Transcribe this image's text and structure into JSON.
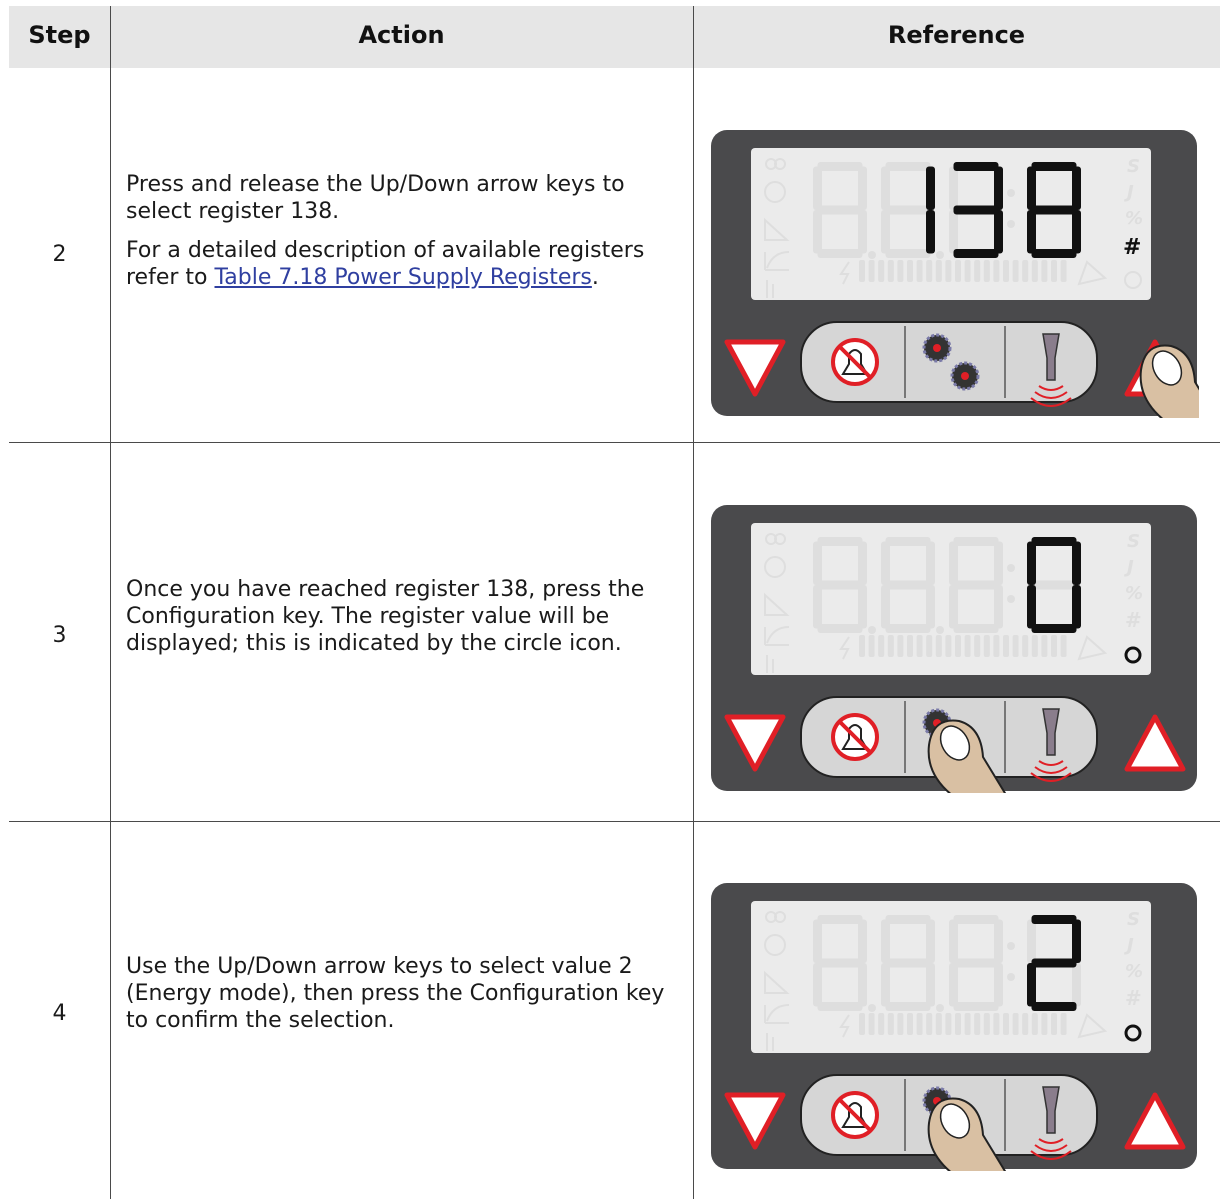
{
  "header": {
    "step": "Step",
    "action": "Action",
    "reference": "Reference"
  },
  "rows": [
    {
      "step": "2",
      "text1": "Press and release the Up/Down arrow keys to select register 138.",
      "text2_prefix": "For a detailed description of available registers refer to ",
      "link": "Table 7.18 Power Supply Registers",
      "text2_suffix": ".",
      "display": {
        "digits": "138",
        "indicator": "#"
      }
    },
    {
      "step": "3",
      "text1": "Once you have reached register 138, press the Configuration key. The register value will be displayed; this is indicated by the circle icon.",
      "display": {
        "digits": "0",
        "indicator": "O"
      }
    },
    {
      "step": "4",
      "text1": "Use the Up/Down arrow keys to select value 2 (Energy mode), then press the Configuration key to confirm the selection.",
      "display": {
        "digits": "2",
        "indicator": "O"
      }
    }
  ],
  "icons": {
    "down": "down-arrow-icon",
    "mute": "mute-bell-icon",
    "config": "configuration-gears-icon",
    "sonotrode": "sonotrode-icon",
    "up": "up-arrow-icon",
    "finger": "pressing-finger-icon"
  },
  "colors": {
    "panel": "#4a4a4c",
    "lcd": "#ebebeb",
    "ghost": "#dedede",
    "digit": "#111111",
    "arrow": "#e01f26",
    "key": "#d6d6d6",
    "finger": "#d9c0a3",
    "link": "#2f3fa0"
  }
}
